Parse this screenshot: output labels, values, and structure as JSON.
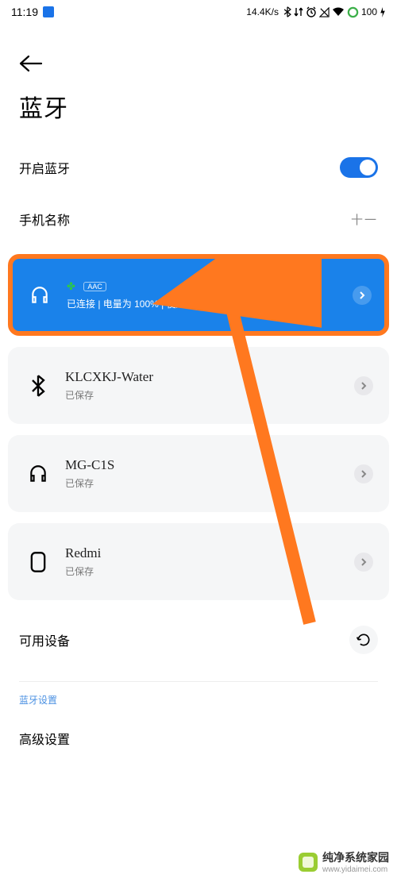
{
  "status": {
    "time": "11:19",
    "speed": "14.4K/s",
    "battery": "100"
  },
  "header": {
    "title": "蓝牙"
  },
  "toggle_row": {
    "label": "开启蓝牙",
    "on": true
  },
  "phone_name_row": {
    "label": "手机名称",
    "value": "十一"
  },
  "devices": [
    {
      "active": true,
      "icon": "headphones",
      "name": "",
      "badge": "AAC",
      "sub": "已连接 | 电量为 100% | 使用中"
    },
    {
      "active": false,
      "icon": "bluetooth",
      "name": "KLCXKJ-Water",
      "sub": "已保存"
    },
    {
      "active": false,
      "icon": "headphones",
      "name": "MG-C1S",
      "sub": "已保存"
    },
    {
      "active": false,
      "icon": "device",
      "name": "Redmi",
      "sub": "已保存"
    }
  ],
  "available": {
    "label": "可用设备"
  },
  "section": {
    "label": "蓝牙设置"
  },
  "advanced": {
    "label": "高级设置"
  },
  "watermark": {
    "line1": "纯净系统家园",
    "line2": "www.yidaimei.com"
  }
}
